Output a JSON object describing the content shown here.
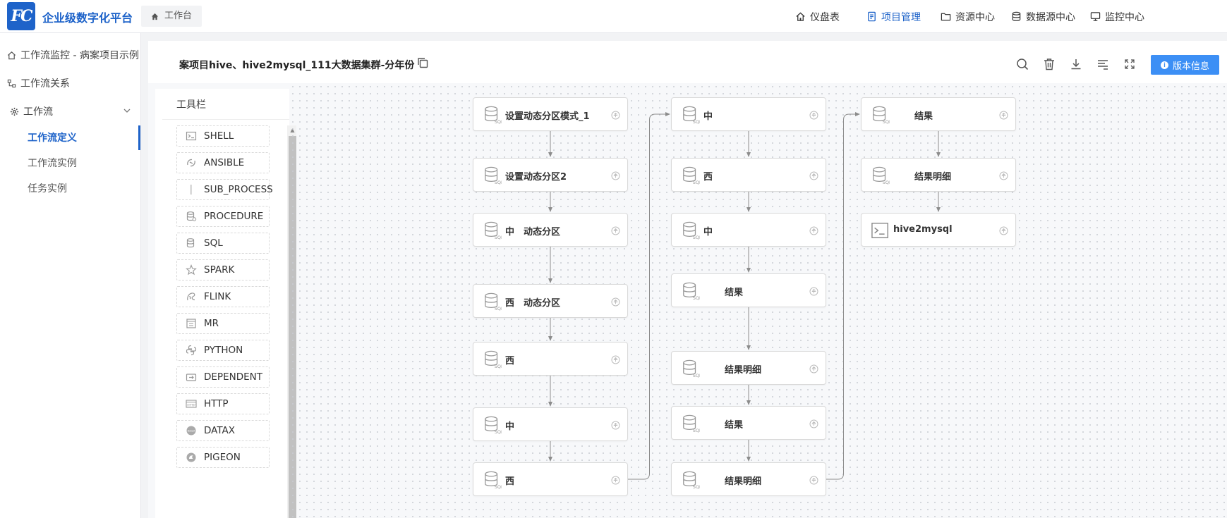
{
  "header": {
    "brand": "企业级数字化平台",
    "logo_text": "FC",
    "home_tab": "工作台",
    "nav": [
      {
        "label": "仪盘表",
        "icon": "home-icon"
      },
      {
        "label": "项目管理",
        "icon": "document-icon",
        "active": true
      },
      {
        "label": "资源中心",
        "icon": "folder-icon"
      },
      {
        "label": "数据源中心",
        "icon": "database-icon"
      },
      {
        "label": "监控中心",
        "icon": "monitor-icon"
      }
    ]
  },
  "sidebar": {
    "items": [
      {
        "label": "工作流监控 - 病案项目示例",
        "icon": "home-icon"
      },
      {
        "label": "工作流关系",
        "icon": "relation-icon"
      },
      {
        "label": "工作流",
        "icon": "gear-icon"
      }
    ],
    "sub_items": [
      {
        "label": "工作流定义",
        "active": true
      },
      {
        "label": "工作流实例"
      },
      {
        "label": "任务实例"
      }
    ]
  },
  "workflow": {
    "title": "案项目hive、hive2mysql_111大数据集群-分年份",
    "version_button": "版本信息"
  },
  "toolbox": {
    "title": "工具栏",
    "items": [
      {
        "label": "SHELL",
        "icon": "shell-icon"
      },
      {
        "label": "ANSIBLE",
        "icon": "ansible-icon"
      },
      {
        "label": "SUB_PROCESS",
        "icon": "sub-process-icon"
      },
      {
        "label": "PROCEDURE",
        "icon": "procedure-icon"
      },
      {
        "label": "SQL",
        "icon": "sql-icon"
      },
      {
        "label": "SPARK",
        "icon": "spark-icon"
      },
      {
        "label": "FLINK",
        "icon": "flink-icon"
      },
      {
        "label": "MR",
        "icon": "mr-icon"
      },
      {
        "label": "PYTHON",
        "icon": "python-icon"
      },
      {
        "label": "DEPENDENT",
        "icon": "dependent-icon"
      },
      {
        "label": "HTTP",
        "icon": "http-icon"
      },
      {
        "label": "DATAX",
        "icon": "datax-icon"
      },
      {
        "label": "PIGEON",
        "icon": "pigeon-icon"
      }
    ]
  },
  "dag": {
    "columns": [
      [
        {
          "label": "设置动态分区模式_1",
          "type": "sql"
        },
        {
          "label": "设置动态分区2",
          "type": "sql"
        },
        {
          "label": "中　动态分区",
          "type": "sql"
        },
        {
          "label": "西　动态分区",
          "type": "sql"
        },
        {
          "label": "西",
          "type": "sql"
        },
        {
          "label": "中",
          "type": "sql"
        },
        {
          "label": "西",
          "type": "sql"
        }
      ],
      [
        {
          "label": "中",
          "type": "sql"
        },
        {
          "label": "西",
          "type": "sql"
        },
        {
          "label": "中",
          "type": "sql"
        },
        {
          "label": "结果",
          "type": "sql"
        },
        {
          "label": "结果明细",
          "type": "sql"
        },
        {
          "label": "结果",
          "type": "sql"
        },
        {
          "label": "结果明细",
          "type": "sql"
        }
      ],
      [
        {
          "label": "结果",
          "type": "sql"
        },
        {
          "label": "结果明细",
          "type": "sql"
        },
        {
          "label": "hive2mysql",
          "type": "shell"
        }
      ]
    ]
  }
}
